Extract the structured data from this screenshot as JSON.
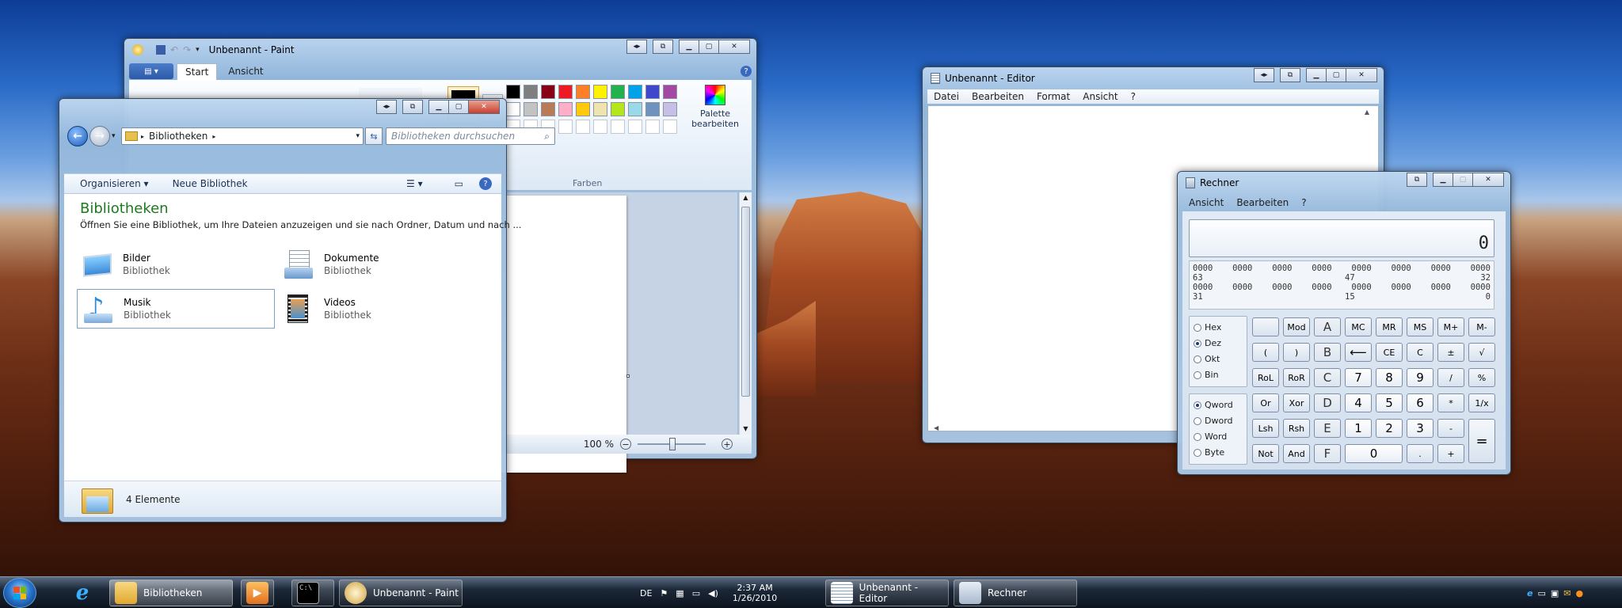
{
  "paint": {
    "title": "Unbenannt - Paint",
    "tabs": [
      "Start",
      "Ansicht"
    ],
    "group_farben": "Farben",
    "palette_line1": "Palette",
    "palette_line2": "bearbeiten",
    "zoom": "100 %",
    "colors_row1": [
      "#000000",
      "#7f7f7f",
      "#880015",
      "#ed1c24",
      "#ff7f27",
      "#fff200",
      "#22b14c",
      "#00a2e8",
      "#3f48cc",
      "#a349a4"
    ],
    "colors_row2": [
      "#ffffff",
      "#c3c3c3",
      "#b97a57",
      "#ffaec9",
      "#ffc90e",
      "#efe4b0",
      "#b5e61d",
      "#99d9ea",
      "#7092be",
      "#c8bfe7"
    ]
  },
  "explorer": {
    "address": "Bibliotheken",
    "search_placeholder": "Bibliotheken durchsuchen",
    "cmd_organize": "Organisieren",
    "cmd_new_library": "Neue Bibliothek",
    "heading": "Bibliotheken",
    "description": "Öffnen Sie eine Bibliothek, um Ihre Dateien anzuzeigen und sie nach Ordner, Datum und nach ...",
    "libraries": [
      {
        "name": "Bilder",
        "sub": "Bibliothek"
      },
      {
        "name": "Dokumente",
        "sub": "Bibliothek"
      },
      {
        "name": "Musik",
        "sub": "Bibliothek"
      },
      {
        "name": "Videos",
        "sub": "Bibliothek"
      }
    ],
    "status": "4 Elemente"
  },
  "editor": {
    "title": "Unbenannt - Editor",
    "menu": [
      "Datei",
      "Bearbeiten",
      "Format",
      "Ansicht",
      "?"
    ]
  },
  "calculator": {
    "title": "Rechner",
    "menu": [
      "Ansicht",
      "Bearbeiten",
      "?"
    ],
    "display": "0",
    "bits_row1": [
      "0000",
      "0000",
      "0000",
      "0000",
      "0000",
      "0000",
      "0000",
      "0000"
    ],
    "bits_labels1": [
      "63",
      "47",
      "32"
    ],
    "bits_row2": [
      "0000",
      "0000",
      "0000",
      "0000",
      "0000",
      "0000",
      "0000",
      "0000"
    ],
    "bits_labels2": [
      "31",
      "15",
      "0"
    ],
    "radix": [
      "Hex",
      "Dez",
      "Okt",
      "Bin"
    ],
    "radix_selected": "Dez",
    "wordsize": [
      "Qword",
      "Dword",
      "Word",
      "Byte"
    ],
    "wordsize_selected": "Qword",
    "buttons": {
      "mod": "Mod",
      "a": "A",
      "mc": "MC",
      "mr": "MR",
      "ms": "MS",
      "mplus": "M+",
      "mminus": "M-",
      "lpar": "(",
      "rpar": ")",
      "b": "B",
      "back": "⟵",
      "ce": "CE",
      "c": "C",
      "pm": "±",
      "sqrt": "√",
      "rol": "RoL",
      "ror": "RoR",
      "cc": "C",
      "n7": "7",
      "n8": "8",
      "n9": "9",
      "div": "/",
      "pct": "%",
      "or": "Or",
      "xor": "Xor",
      "d": "D",
      "n4": "4",
      "n5": "5",
      "n6": "6",
      "mul": "*",
      "inv": "1/x",
      "lsh": "Lsh",
      "rsh": "Rsh",
      "e": "E",
      "n1": "1",
      "n2": "2",
      "n3": "3",
      "sub": "-",
      "eq": "=",
      "not": "Not",
      "and": "And",
      "f": "F",
      "n0": "0",
      "dot": ".",
      "add": "+"
    }
  },
  "taskbar": {
    "items": [
      "Bibliotheken",
      "Unbenannt - Paint",
      "Unbenannt - Editor",
      "Rechner"
    ],
    "lang": "DE",
    "time": "2:37 AM",
    "date": "1/26/2010"
  }
}
